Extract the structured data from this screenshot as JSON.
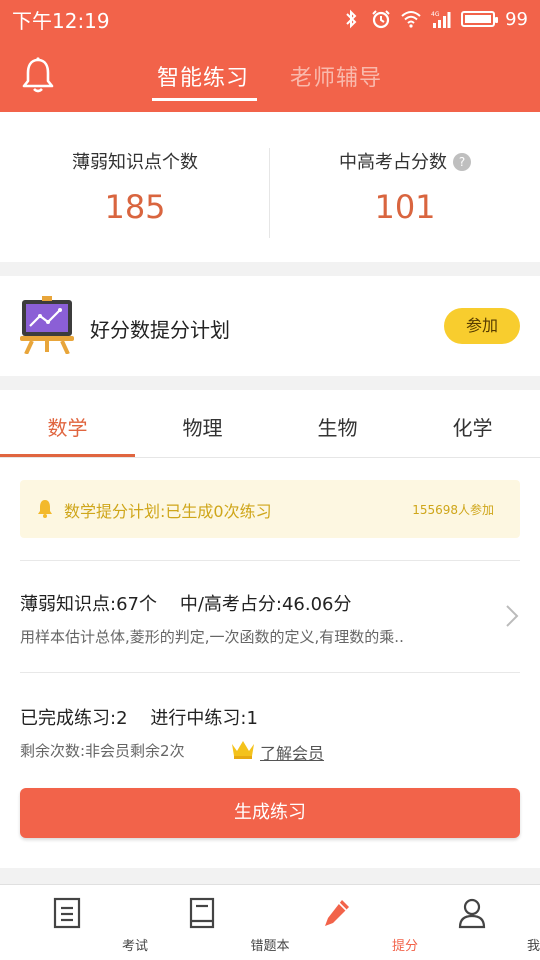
{
  "status_bar": {
    "time": "下午12:19",
    "battery": "99",
    "battery_level_percent": 99,
    "icons": [
      "bluetooth-icon",
      "alarm-icon",
      "wifi-icon",
      "signal-4g-icon",
      "battery-icon"
    ]
  },
  "header": {
    "tabs": [
      {
        "label": "智能练习",
        "active": true
      },
      {
        "label": "老师辅导",
        "active": false
      }
    ],
    "bell_icon": "bell-icon"
  },
  "stats": {
    "weak_points_label": "薄弱知识点个数",
    "weak_points_value": "185",
    "exam_score_label": "中高考占分数",
    "exam_score_value": "101",
    "help_icon_glyph": "?"
  },
  "plan": {
    "title": "好分数提分计划",
    "join_label": "参加",
    "icon": "easel-chart-icon"
  },
  "subjects": {
    "tabs": [
      "数学",
      "物理",
      "生物",
      "化学"
    ],
    "active_index": 0
  },
  "notice": {
    "text": "数学提分计划:已生成0次练习",
    "count": "155698人参加"
  },
  "weak": {
    "title": "薄弱知识点:67个    中/高考占分:46.06分",
    "description": "用样本估计总体,菱形的判定,一次函数的定义,有理数的乘.."
  },
  "progress": {
    "summary": "已完成练习:2    进行中练习:1",
    "remaining": "剩余次数:非会员剩余2次",
    "member_link": "了解会员"
  },
  "generate_button": "生成练习",
  "bottom_nav": [
    {
      "label": "考试",
      "icon": "exam-icon",
      "active": false
    },
    {
      "label": "错题本",
      "icon": "notebook-icon",
      "active": false
    },
    {
      "label": "提分",
      "icon": "pencil-icon",
      "active": true
    },
    {
      "label": "我的",
      "icon": "person-icon",
      "active": false
    }
  ],
  "colors": {
    "primary": "#f2634a",
    "accent_text": "#e0653f",
    "notice_bg": "#fdf7e1",
    "notice_text": "#cfa61a",
    "join_button": "#f8cd2e"
  }
}
